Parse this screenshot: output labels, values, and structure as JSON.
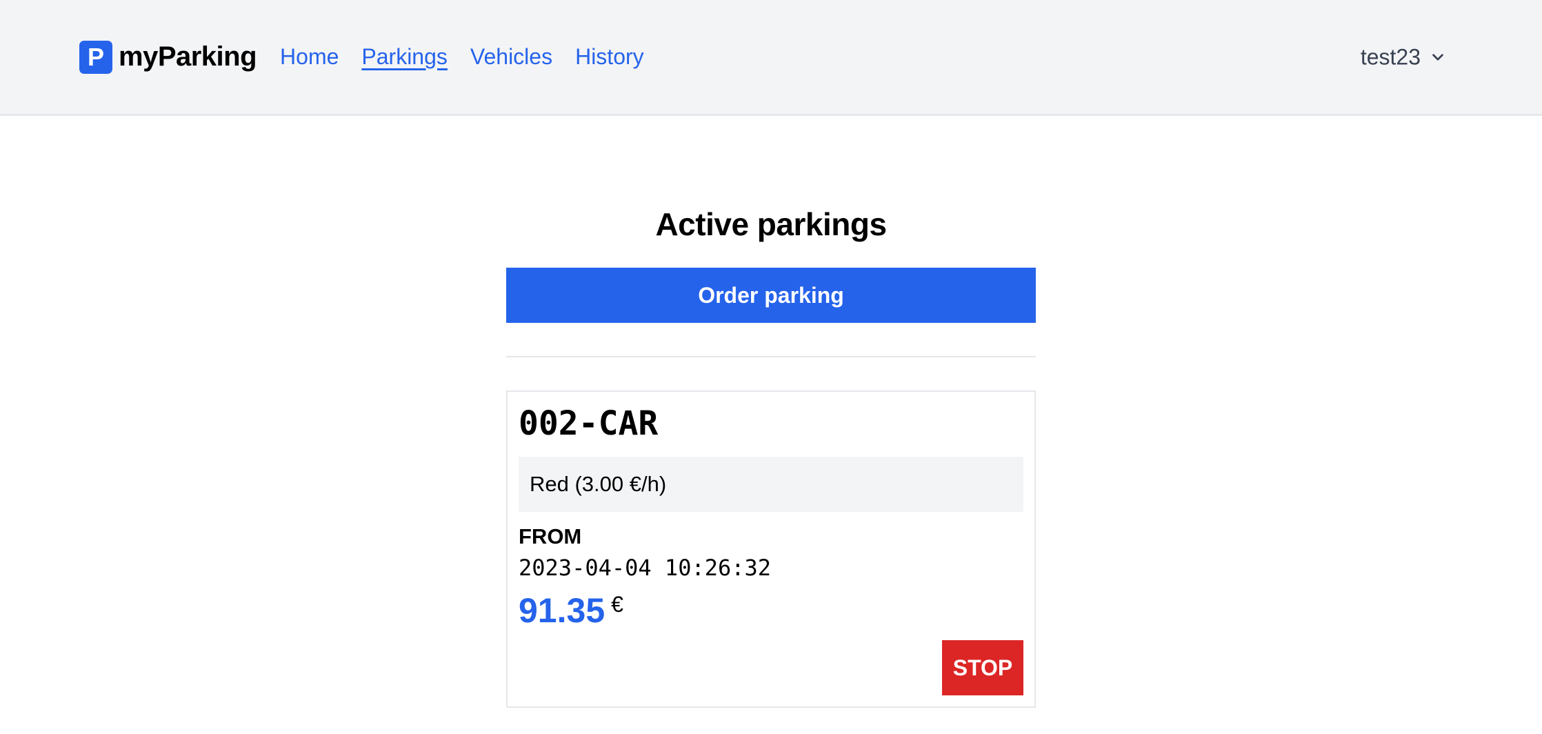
{
  "navbar": {
    "brand_letter": "P",
    "brand_name": "myParking",
    "links": [
      {
        "label": "Home",
        "active": false
      },
      {
        "label": "Parkings",
        "active": true
      },
      {
        "label": "Vehicles",
        "active": false
      },
      {
        "label": "History",
        "active": false
      }
    ],
    "user": "test23",
    "user_icon": "chevron-down-icon"
  },
  "main": {
    "title": "Active parkings",
    "order_button": "Order parking"
  },
  "parkings": [
    {
      "plate": "002-CAR",
      "zone": "Red (3.00 €/h)",
      "from_label": "FROM",
      "from_value": "2023-04-04 10:26:32",
      "price": "91.35",
      "currency": "€",
      "stop_button": "STOP"
    }
  ],
  "colors": {
    "primary": "#2563eb",
    "danger": "#dc2626",
    "navbar_bg": "#f3f4f6"
  }
}
